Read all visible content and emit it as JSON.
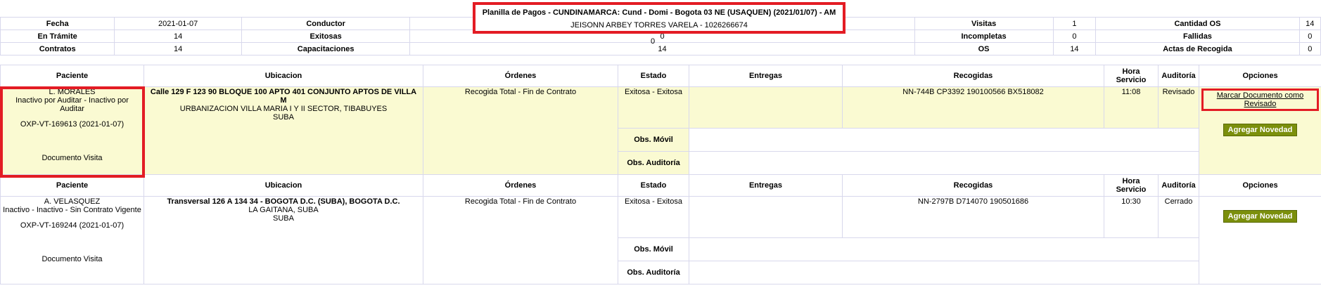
{
  "title": {
    "line1": "Planilla de Pagos - CUNDINAMARCA: Cund - Domi - Bogota 03 NE (USAQUEN) (2021/01/07) - AM",
    "line2": "JEISONN ARBEY TORRES VARELA - 1026266674"
  },
  "summary": {
    "fecha_label": "Fecha",
    "fecha": "2021-01-07",
    "conductor_label": "Conductor",
    "conductor": "0",
    "visitas_label": "Visitas",
    "visitas": "1",
    "cantidad_os_label": "Cantidad OS",
    "cantidad_os": "14",
    "tramite_label": "En Trámite",
    "tramite": "14",
    "exitosas_label": "Exitosas",
    "exitosas": "0",
    "incompletas_label": "Incompletas",
    "incompletas": "0",
    "fallidas_label": "Fallidas",
    "fallidas": "0",
    "contratos_label": "Contratos",
    "contratos": "14",
    "capacitaciones_label": "Capacitaciones",
    "capacitaciones": "14",
    "os_label": "OS",
    "os": "14",
    "actas_label": "Actas de Recogida",
    "actas": "0"
  },
  "headers": {
    "paciente": "Paciente",
    "ubicacion": "Ubicacion",
    "ordenes": "Órdenes",
    "estado": "Estado",
    "entregas": "Entregas",
    "recogidas": "Recogidas",
    "hora_1": "Hora",
    "hora_2": "Servicio",
    "auditoria": "Auditoría",
    "opciones": "Opciones"
  },
  "obs": {
    "movil": "Obs. Móvil",
    "auditoria": "Obs. Auditoría"
  },
  "records": [
    {
      "name": "L. MORALES",
      "status": "Inactivo por Auditar - Inactivo por Auditar",
      "code": "OXP-VT-169613 (2021-01-07)",
      "doc": "Documento Visita",
      "address": "Calle 129 F 123 90 BLOQUE 100 APTO 401 CONJUNTO APTOS DE VILLA M",
      "address2": "URBANIZACION VILLA MARIA I Y II SECTOR, TIBABUYES",
      "address3": "SUBA",
      "orden": "Recogida Total - Fin de Contrato",
      "estado": "Exitosa - Exitosa",
      "entregas": "",
      "recogidas": "NN-744B CP3392 190100566 BX518082",
      "hora": "11:08",
      "auditoria": "Revisado",
      "marcar": "Marcar Documento como Revisado",
      "novedad": "Agregar Novedad"
    },
    {
      "name": "A. VELASQUEZ",
      "status": "Inactivo - Inactivo - Sin Contrato Vigente",
      "code": "OXP-VT-169244 (2021-01-07)",
      "doc": "Documento Visita",
      "address": "Transversal 126 A 134 34 - BOGOTA D.C. (SUBA), BOGOTA D.C.",
      "address2": "LA GAITANA, SUBA",
      "address3": "SUBA",
      "orden": "Recogida Total - Fin de Contrato",
      "estado": "Exitosa - Exitosa",
      "entregas": "",
      "recogidas": "NN-2797B D714070 190501686",
      "hora": "10:30",
      "auditoria": "Cerrado",
      "novedad": "Agregar Novedad"
    }
  ]
}
